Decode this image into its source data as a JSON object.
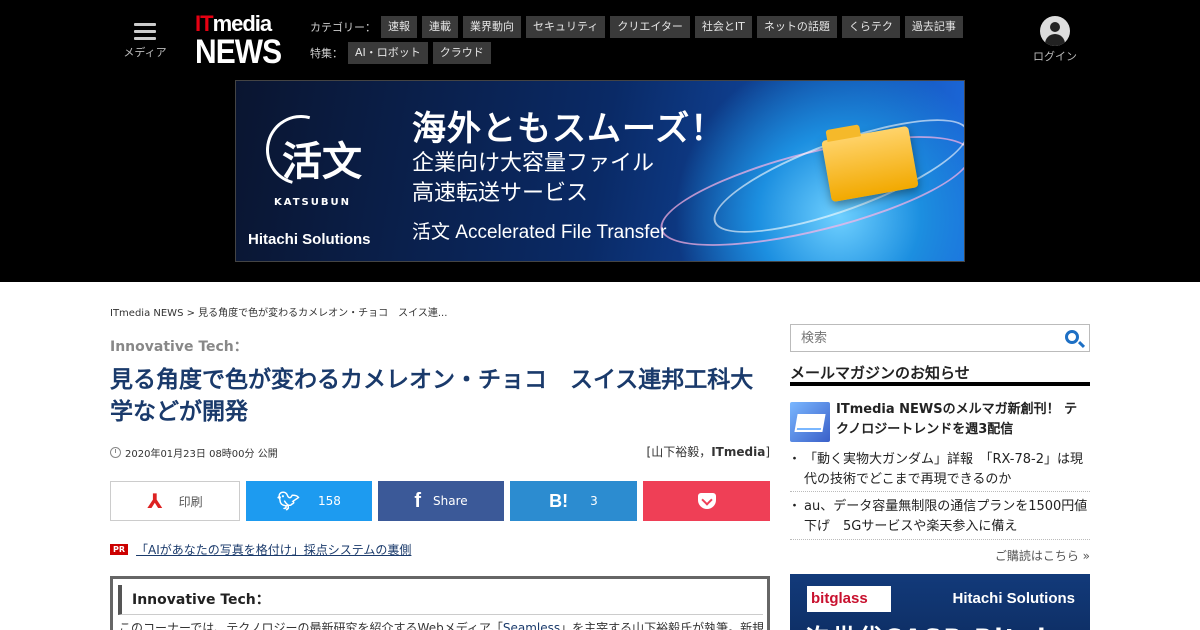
{
  "header": {
    "menu_label": "メディア",
    "logo_it": "IT",
    "logo_media": "media",
    "logo_news": "NEWS",
    "category_caption": "カテゴリー：",
    "categories": [
      "速報",
      "連載",
      "業界動向",
      "セキュリティ",
      "クリエイター",
      "社会とIT",
      "ネットの話題",
      "くらテク",
      "過去記事"
    ],
    "feature_caption": "特集：",
    "features": [
      "AI・ロボット",
      "クラウド"
    ],
    "login_label": "ログイン"
  },
  "banner": {
    "logo_kanji": "活文",
    "logo_sub": "KATSUBUN",
    "company": "Hitachi Solutions",
    "headline": "海外ともスムーズ！",
    "line1": "企業向け大容量ファイル",
    "line2": "高速転送サービス",
    "line3": "活文 Accelerated File Transfer"
  },
  "breadcrumb": "ITmedia NEWS > 見る角度で色が変わるカメレオン・チョコ　スイス連...",
  "article": {
    "series": "Innovative Tech：",
    "title": "見る角度で色が変わるカメレオン・チョコ　スイス連邦工科大学などが開発",
    "date": "2020年01月23日 08時00分 公開",
    "byline_author": "[山下裕毅，",
    "byline_pub": "ITmedia",
    "byline_close": "]"
  },
  "share": {
    "print_label": "印刷",
    "twitter_count": "158",
    "facebook_label": "Share",
    "hatena_icon": "B!",
    "hatena_count": "3"
  },
  "pr": {
    "badge": "PR",
    "text": "「AIがあなたの写真を格付け」採点システムの裏側"
  },
  "series_box": {
    "title": "Innovative Tech：",
    "body_before": "このコーナーでは、テクノロジーの最新研究を紹介するWebメディア「",
    "body_link": "Seamless",
    "body_after": "」を主宰する山下裕毅氏が執筆。新規"
  },
  "sidebar": {
    "search_placeholder": "検索",
    "mail_heading": "メールマガジンのお知らせ",
    "mail_feature": "ITmedia NEWSのメルマガ新創刊！ テクノロジートレンドを週3配信",
    "mail_items": [
      "「動く実物大ガンダム」詳報　「RX-78-2」は現代の技術でどこまで再現できるのか",
      "au、データ容量無制限の通信プランを1500円値下げ　5Gサービスや楽天参入に備え"
    ],
    "mail_more": "ご購読はこちら »"
  },
  "ad2": {
    "brand": "bitglass",
    "company": "Hitachi Solutions",
    "headline": "次世代CASB Bitglass"
  },
  "colors": {
    "header_bg": "#000000",
    "title": "#1a3a6b",
    "twitter": "#1d9bf0",
    "facebook": "#3b5998",
    "hatena": "#2c8cd0",
    "pocket": "#ef3f56"
  },
  "icons": [
    "menu-icon",
    "user-avatar-icon",
    "clock-icon",
    "print-icon",
    "twitter-icon",
    "facebook-icon",
    "hatena-icon",
    "pocket-icon",
    "search-icon",
    "mail-icon"
  ]
}
